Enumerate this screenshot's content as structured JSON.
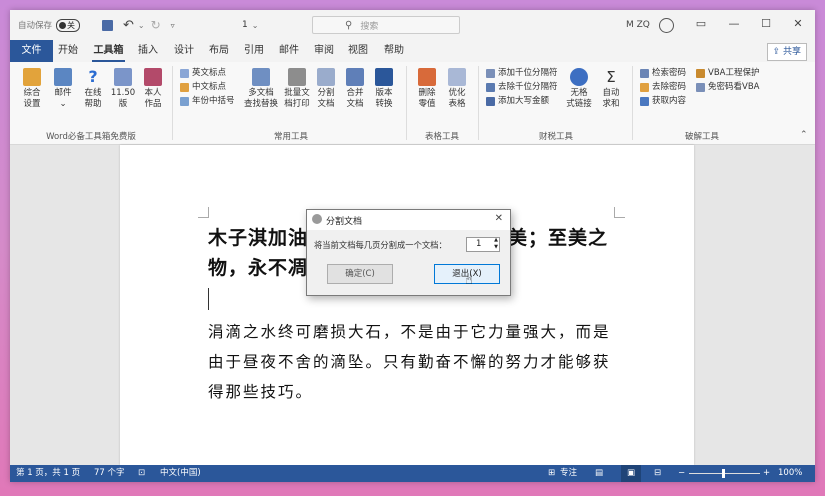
{
  "titlebar": {
    "autosave_label": "自动保存",
    "autosave_state": "关",
    "doc_name": "1",
    "search_placeholder": "搜索",
    "user": "M ZQ"
  },
  "menu": {
    "file": "文件",
    "tabs": [
      "开始",
      "工具箱",
      "插入",
      "设计",
      "布局",
      "引用",
      "邮件",
      "审阅",
      "视图",
      "帮助"
    ],
    "active_tab": "工具箱",
    "share": "共享"
  },
  "ribbon": {
    "groups": [
      "Word必备工具箱免费版",
      "常用工具",
      "表格工具",
      "财税工具",
      "破解工具"
    ],
    "g1": {
      "btn1": [
        "综合",
        "设置"
      ],
      "btn2": [
        "邮件",
        "⌄"
      ],
      "btn3": [
        "在线",
        "帮助"
      ],
      "btn4": [
        "11.50",
        "版"
      ],
      "btn5": [
        "本人",
        "作品"
      ]
    },
    "g2": {
      "small": [
        "英文标点",
        "中文标点",
        "年份中括号"
      ],
      "btn1": [
        "多文档",
        "查找替换"
      ],
      "btn2": [
        "批量文",
        "档打印"
      ],
      "btn3": [
        "分割",
        "文档"
      ],
      "btn4": [
        "合并",
        "文档"
      ],
      "btn5": [
        "版本",
        "转换"
      ]
    },
    "g3": {
      "btn1": [
        "删除",
        "零值"
      ],
      "btn2": [
        "优化",
        "表格"
      ]
    },
    "g4": {
      "small": [
        "添加千位分隔符",
        "去除千位分隔符",
        "添加大写金额"
      ],
      "btn1": [
        "无格",
        "式链接"
      ],
      "btn2": [
        "自动",
        "求和"
      ]
    },
    "g5": {
      "small": [
        "检索密码",
        "去除密码",
        "获取内容"
      ],
      "small2": [
        "VBA工程保护",
        "免密码看VBA"
      ]
    }
  },
  "document": {
    "heading_line1_left": "木子淇加油",
    "heading_line1_right": "美；至美之",
    "heading_line2": "物，永不凋",
    "body_lines": [
      "涓滴之水终可磨损大石，不是由于它力量强大，而是",
      "由于昼夜不舍的滴坠。只有勤奋不懈的努力才能够获",
      "得那些技巧。"
    ]
  },
  "dialog": {
    "title": "分割文档",
    "prompt": "将当前文档每几页分割成一个文档：",
    "value": "1",
    "ok_label": "确定(C)",
    "exit_label": "退出(X)"
  },
  "statusbar": {
    "page": "第 1 页，共 1 页",
    "words": "77 个字",
    "language": "中文(中国)",
    "focus": "专注",
    "zoom": "100%",
    "zoom_minus": "−",
    "zoom_plus": "+"
  },
  "colors": {
    "accent": "#2b579a",
    "background_gradient_top": "#c98ad8",
    "background_gradient_bottom": "#e078b8"
  }
}
